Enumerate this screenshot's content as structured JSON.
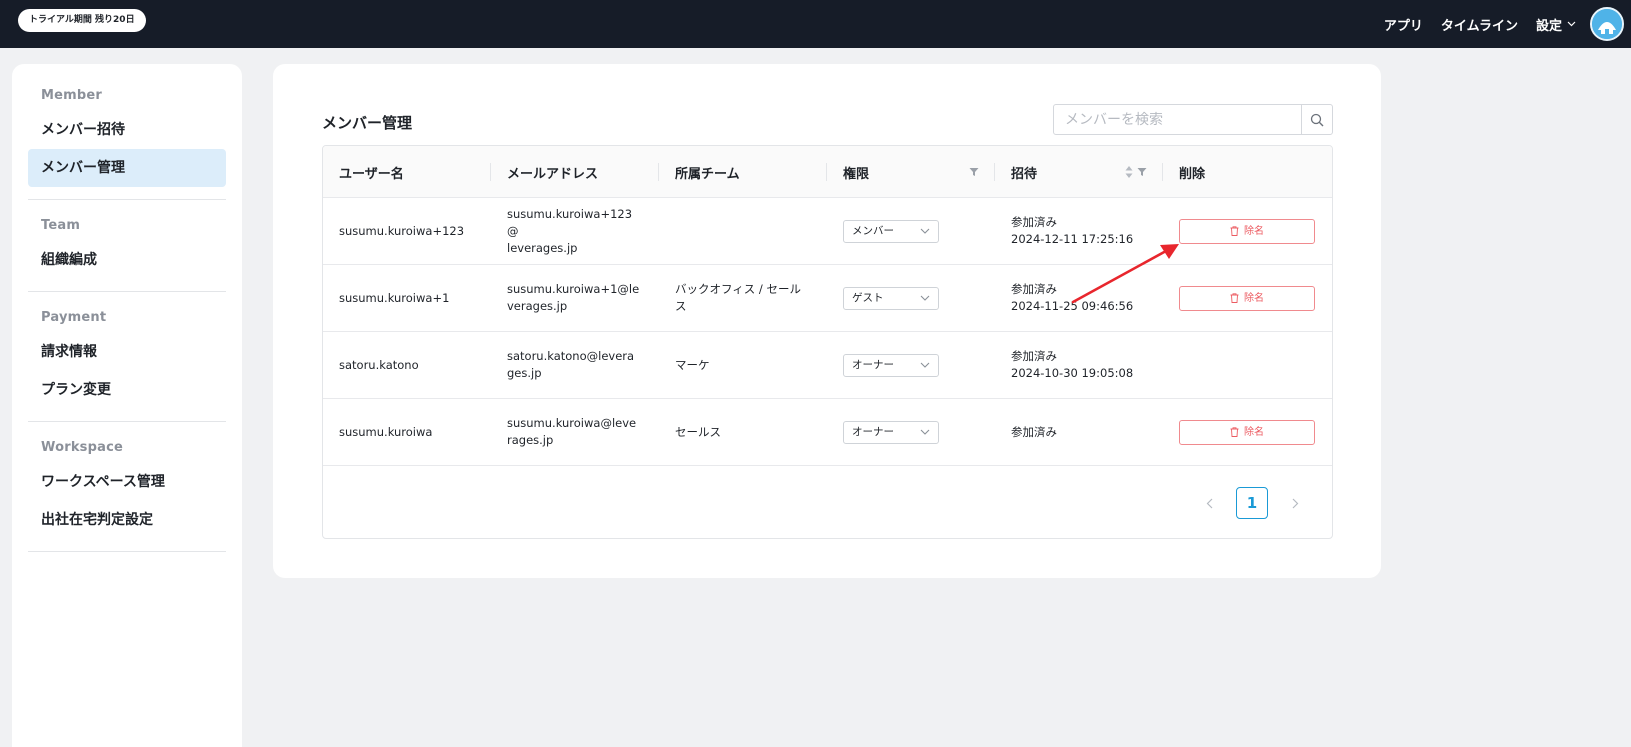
{
  "topbar": {
    "trial_badge": "トライアル期間 残り20日",
    "nav": {
      "apps": "アプリ",
      "timeline": "タイムライン",
      "settings": "設定"
    }
  },
  "sidebar": {
    "groups": [
      {
        "title": "Member",
        "items": [
          {
            "label": "メンバー招待"
          },
          {
            "label": "メンバー管理",
            "active": true
          }
        ]
      },
      {
        "title": "Team",
        "items": [
          {
            "label": "組織編成"
          }
        ]
      },
      {
        "title": "Payment",
        "items": [
          {
            "label": "請求情報"
          },
          {
            "label": "プラン変更"
          }
        ]
      },
      {
        "title": "Workspace",
        "items": [
          {
            "label": "ワークスペース管理"
          },
          {
            "label": "出社在宅判定設定"
          }
        ]
      }
    ]
  },
  "main": {
    "title": "メンバー管理",
    "search": {
      "placeholder": "メンバーを検索",
      "value": ""
    },
    "columns": [
      "ユーザー名",
      "メールアドレス",
      "所属チーム",
      "権限",
      "招待",
      "削除"
    ],
    "rows": [
      {
        "username": "susumu.kuroiwa+123",
        "email": [
          "susumu.kuroiwa+123@",
          "leverages.jp"
        ],
        "team": [],
        "role": "メンバー",
        "invite_status": "参加済み",
        "invite_date": "2024-12-11 17:25:16",
        "remove_label": "除名"
      },
      {
        "username": "susumu.kuroiwa+1",
        "email": [
          "susumu.kuroiwa+1@le",
          "verages.jp"
        ],
        "team": [
          "バックオフィス / セール",
          "ス"
        ],
        "role": "ゲスト",
        "invite_status": "参加済み",
        "invite_date": "2024-11-25 09:46:56",
        "remove_label": "除名"
      },
      {
        "username": "satoru.katono",
        "email": [
          "satoru.katono@levera",
          "ges.jp"
        ],
        "team": [
          "マーケ"
        ],
        "role": "オーナー",
        "invite_status": "参加済み",
        "invite_date": "2024-10-30 19:05:08",
        "remove_label": null
      },
      {
        "username": "susumu.kuroiwa",
        "email": [
          "susumu.kuroiwa@leve",
          "rages.jp"
        ],
        "team": [
          "セールス"
        ],
        "role": "オーナー",
        "invite_status": "参加済み",
        "invite_date": "",
        "remove_label": "除名"
      }
    ],
    "pagination": {
      "current": "1"
    }
  },
  "colors": {
    "topbar": "#161c28",
    "accent": "#1a9ad6",
    "danger": "#ec5b61",
    "active_bg": "#dcedfa",
    "annotation": "#e8262d"
  },
  "icons": [
    "search-icon",
    "filter-icon",
    "sort-icon",
    "chevron-down-icon",
    "trash-icon",
    "chevron-left-icon",
    "chevron-right-icon"
  ]
}
